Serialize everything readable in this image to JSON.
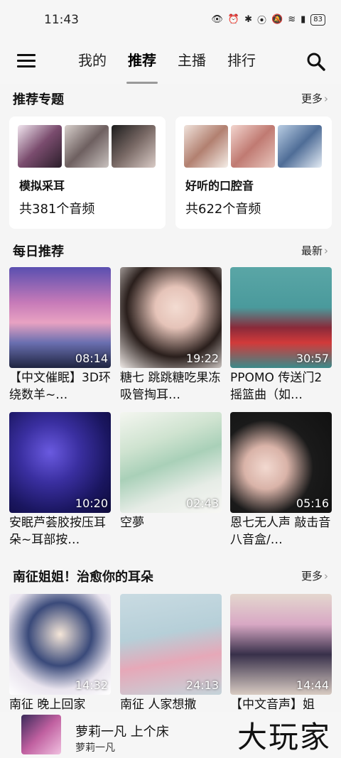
{
  "status": {
    "time": "11:43",
    "battery": "83"
  },
  "nav": {
    "tabs": [
      "我的",
      "推荐",
      "主播",
      "排行"
    ],
    "active": "推荐"
  },
  "topics": {
    "title": "推荐专题",
    "more": "更多",
    "items": [
      {
        "name": "模拟采耳",
        "count": "共381个音频"
      },
      {
        "name": "好听的口腔音",
        "count": "共622个音频"
      }
    ]
  },
  "daily": {
    "title": "每日推荐",
    "more": "最新",
    "items": [
      {
        "title": "【中文催眠】3D环绕数羊~…",
        "duration": "08:14"
      },
      {
        "title": "糖七 跳跳糖吃果冻吸管掏耳…",
        "duration": "19:22"
      },
      {
        "title": "PPOMO 传送门2摇篮曲（如…",
        "duration": "30:57"
      },
      {
        "title": "安眠芦荟胶按压耳朵~耳部按…",
        "duration": "10:20"
      },
      {
        "title": "空夢",
        "duration": "02:43"
      },
      {
        "title": "恩七无人声 敲击音八音盒/…",
        "duration": "05:16"
      }
    ]
  },
  "nanzheng": {
    "title": "南征姐姐！治愈你的耳朵",
    "more": "更多",
    "items": [
      {
        "title": "南征 晚上回家",
        "duration": "14:32"
      },
      {
        "title": "南征 人家想撒",
        "duration": "24:13"
      },
      {
        "title": "【中文音声】姐",
        "duration": "14:44"
      }
    ]
  },
  "player": {
    "title": "萝莉一凡 上个床",
    "artist": "萝莉一凡"
  },
  "watermark": "大玩家"
}
